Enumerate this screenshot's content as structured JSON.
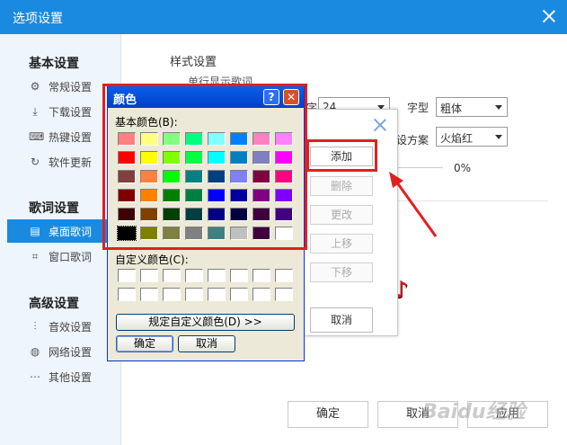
{
  "window": {
    "title": "选项设置"
  },
  "sidebar": {
    "sections": [
      {
        "title": "基本设置",
        "items": [
          {
            "label": "常规设置",
            "icon": "settings-icon"
          },
          {
            "label": "下载设置",
            "icon": "download-icon"
          },
          {
            "label": "热键设置",
            "icon": "keyboard-icon"
          },
          {
            "label": "软件更新",
            "icon": "refresh-icon"
          }
        ]
      },
      {
        "title": "歌词设置",
        "items": [
          {
            "label": "桌面歌词",
            "icon": "desktop-lyrics-icon"
          },
          {
            "label": "窗口歌词",
            "icon": "window-lyrics-icon"
          }
        ]
      },
      {
        "title": "高级设置",
        "items": [
          {
            "label": "音效设置",
            "icon": "equalizer-icon"
          },
          {
            "label": "网络设置",
            "icon": "globe-icon"
          },
          {
            "label": "其他设置",
            "icon": "more-icon"
          }
        ]
      }
    ]
  },
  "content": {
    "style_section_title": "样式设置",
    "single_line_text": "单行显示歌词",
    "font_size_value": "24",
    "font_type_label": "字型",
    "font_type_value": "粗体",
    "scheme_label": "设方案",
    "scheme_value": "火焰红",
    "percent_value": "0%",
    "partial_char": "字",
    "ok": "确定",
    "cancel": "取消",
    "apply": "应用"
  },
  "dialog2": {
    "add": "添加",
    "delete": "删除",
    "modify": "更改",
    "move_up": "上移",
    "move_down": "下移",
    "cancel": "取消"
  },
  "colordlg": {
    "title": "颜色",
    "basic_colors_label": "基本颜色(B):",
    "custom_colors_label": "自定义颜色(C):",
    "define_custom_button": "规定自定义颜色(D) >>",
    "ok": "确定",
    "cancel": "取消",
    "basic_colors": [
      [
        "#ff8080",
        "#ffff80",
        "#80ff80",
        "#00ff80",
        "#80ffff",
        "#0080ff",
        "#ff80c0",
        "#ff80ff"
      ],
      [
        "#ff0000",
        "#ffff00",
        "#80ff00",
        "#00ff40",
        "#00ffff",
        "#0080c0",
        "#8080c0",
        "#ff00ff"
      ],
      [
        "#804040",
        "#ff8040",
        "#00ff00",
        "#008080",
        "#004080",
        "#8080ff",
        "#800040",
        "#ff0080"
      ],
      [
        "#800000",
        "#ff8000",
        "#008000",
        "#008040",
        "#0000ff",
        "#0000a0",
        "#800080",
        "#8000ff"
      ],
      [
        "#400000",
        "#804000",
        "#004000",
        "#004040",
        "#000080",
        "#000040",
        "#400040",
        "#400080"
      ],
      [
        "#000000",
        "#808000",
        "#808040",
        "#808080",
        "#408080",
        "#c0c0c0",
        "#400040",
        "#ffffff"
      ]
    ],
    "selected_index": [
      5,
      0
    ]
  },
  "watermark": "Baidu经验"
}
